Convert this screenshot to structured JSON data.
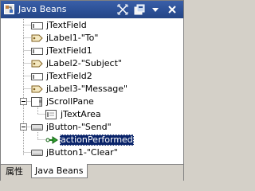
{
  "view": {
    "title": "Java Beans",
    "toolbar": {
      "collapse_icon": "expand-collapse-icon",
      "view_menu_icon": "view-menu-icon",
      "menu_arrow_icon": "chevron-down-icon",
      "close_icon": "close-icon"
    }
  },
  "tree": {
    "items": [
      {
        "label": "jTextField",
        "icon": "textfield-icon"
      },
      {
        "label": "jLabel1-\"To\"",
        "icon": "label-icon"
      },
      {
        "label": "jTextField1",
        "icon": "textfield-icon"
      },
      {
        "label": "jLabel2-\"Subject\"",
        "icon": "label-icon"
      },
      {
        "label": "jTextField2",
        "icon": "textfield-icon"
      },
      {
        "label": "jLabel3-\"Message\"",
        "icon": "label-icon"
      },
      {
        "label": "jScrollPane",
        "icon": "scrollpane-icon"
      },
      {
        "label": "jTextArea",
        "icon": "textarea-icon"
      },
      {
        "label": "jButton-\"Send\"",
        "icon": "button-icon"
      },
      {
        "label": "actionPerformed",
        "icon": "event-handler-icon"
      },
      {
        "label": "jButton1-\"Clear\"",
        "icon": "button-icon"
      }
    ]
  },
  "tabs": [
    {
      "label": "属性",
      "active": false
    },
    {
      "label": "Java Beans",
      "active": true
    }
  ],
  "colors": {
    "title_bg": "#2b4f95",
    "selection_bg": "#0a246a",
    "panel_bg": "#ffffff",
    "chrome_bg": "#d4d0c8"
  }
}
